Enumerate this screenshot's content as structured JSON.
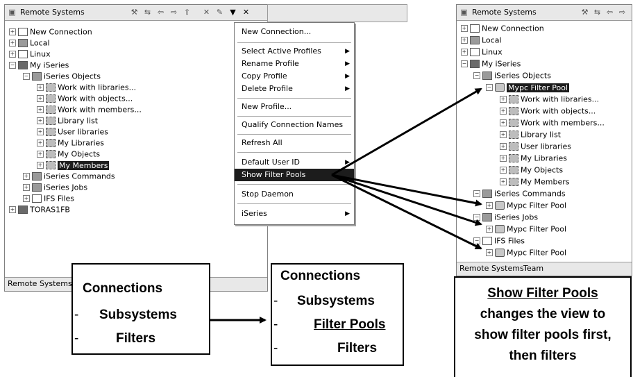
{
  "left_panel": {
    "title": "Remote Systems",
    "status_tab": "Remote Systems",
    "tree": [
      {
        "label": "New Connection"
      },
      {
        "label": "Local"
      },
      {
        "label": "Linux"
      },
      {
        "label": "My iSeries"
      },
      {
        "label": "iSeries Objects"
      },
      {
        "label": "Work with libraries..."
      },
      {
        "label": "Work with objects..."
      },
      {
        "label": "Work with members..."
      },
      {
        "label": "Library list"
      },
      {
        "label": "User libraries"
      },
      {
        "label": "My Libraries"
      },
      {
        "label": "My Objects"
      },
      {
        "label": "My Members"
      },
      {
        "label": "iSeries Commands"
      },
      {
        "label": "iSeries Jobs"
      },
      {
        "label": "IFS Files"
      },
      {
        "label": "TORAS1FB"
      }
    ]
  },
  "context_menu": {
    "items": [
      {
        "label": "New Connection..."
      },
      {
        "label": "Select Active Profiles"
      },
      {
        "label": "Rename Profile"
      },
      {
        "label": "Copy Profile"
      },
      {
        "label": "Delete Profile"
      },
      {
        "label": "New Profile..."
      },
      {
        "label": "Qualify Connection Names"
      },
      {
        "label": "Refresh All"
      },
      {
        "label": "Default User ID"
      },
      {
        "label": "Show Filter Pools"
      },
      {
        "label": "Stop Daemon"
      },
      {
        "label": "iSeries"
      }
    ]
  },
  "right_panel": {
    "title": "Remote Systems",
    "status_tabs": [
      "Remote Systems",
      "Team"
    ],
    "tree": [
      {
        "label": "New Connection"
      },
      {
        "label": "Local"
      },
      {
        "label": "Linux"
      },
      {
        "label": "My iSeries"
      },
      {
        "label": "iSeries Objects"
      },
      {
        "label": "Mypc Filter Pool"
      },
      {
        "label": "Work with libraries..."
      },
      {
        "label": "Work with objects..."
      },
      {
        "label": "Work with members..."
      },
      {
        "label": "Library list"
      },
      {
        "label": "User libraries"
      },
      {
        "label": "My Libraries"
      },
      {
        "label": "My Objects"
      },
      {
        "label": "My Members"
      },
      {
        "label": "iSeries Commands"
      },
      {
        "label": "Mypc Filter Pool"
      },
      {
        "label": "iSeries Jobs"
      },
      {
        "label": "Mypc Filter Pool"
      },
      {
        "label": "IFS Files"
      },
      {
        "label": "Mypc Filter Pool"
      }
    ]
  },
  "callouts": {
    "left": {
      "line1": "Connections",
      "dash1": "-",
      "line2": "Subsystems",
      "dash2": "-",
      "line3": "Filters"
    },
    "middle": {
      "line1": "Connections",
      "dash1": "-",
      "line2": "Subsystems",
      "dash2": "-",
      "line3": "Filter Pools",
      "dash3": "-",
      "line4": "Filters"
    },
    "right": {
      "line1": "Show Filter Pools",
      "line2": "changes the view to",
      "line3": "show filter pools first,",
      "line4": "then filters"
    }
  }
}
